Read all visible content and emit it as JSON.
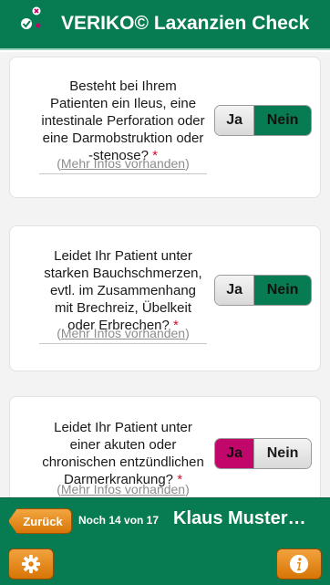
{
  "header": {
    "title": "VERIKO© Laxanzien Check",
    "logo_icon": "veriko-logo-icon"
  },
  "questions": [
    {
      "text": "Besteht bei Ihrem Patienten ein Ileus, eine intestinale Perforation oder eine Darmobstruktion oder -stenose?",
      "required_mark": "*",
      "info_link": "Mehr Infos vorhanden",
      "yes_label": "Ja",
      "no_label": "Nein",
      "selected": "Nein"
    },
    {
      "text": "Leidet Ihr Patient unter starken Bauchschmerzen, evtl. im Zusammenhang mit Brechreiz, Übelkeit oder Erbrechen?",
      "required_mark": "*",
      "info_link": "Mehr Infos vorhanden",
      "yes_label": "Ja",
      "no_label": "Nein",
      "selected": "Nein"
    },
    {
      "text": "Leidet Ihr Patient unter einer akuten oder chronischen entzündlichen Darmerkrankung?",
      "required_mark": "*",
      "info_link": "Mehr Infos vorhanden",
      "yes_label": "Ja",
      "no_label": "Nein",
      "selected": "Ja"
    }
  ],
  "navbar": {
    "back_label": "Zurück",
    "progress_text": "Noch 14 von 17",
    "patient_name": "Klaus Muster…"
  },
  "footer": {
    "settings_icon": "gear-icon",
    "info_icon": "info-icon"
  },
  "colors": {
    "brand_green": "#077b51",
    "accent_orange": "#e58a1f",
    "selected_yes": "#c2076a",
    "required": "#d0112b"
  }
}
